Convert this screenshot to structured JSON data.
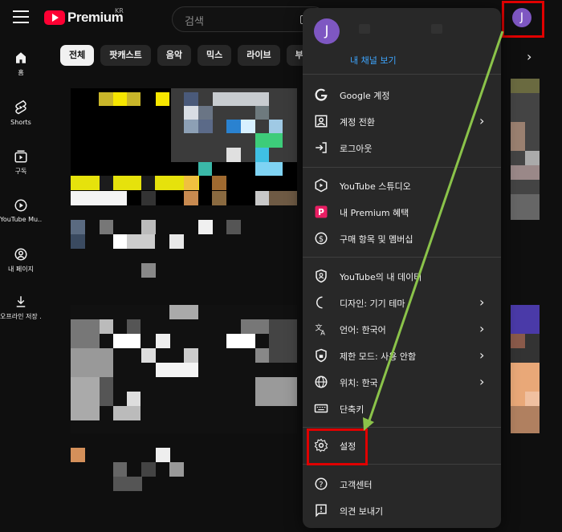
{
  "header": {
    "logo_text": "Premium",
    "region": "KR",
    "search_placeholder": "검색",
    "avatar_letter": "J"
  },
  "sidebar": {
    "items": [
      {
        "label": "홈",
        "icon": "home-icon"
      },
      {
        "label": "Shorts",
        "icon": "shorts-icon"
      },
      {
        "label": "구독",
        "icon": "subscriptions-icon"
      },
      {
        "label": "YouTube Mu...",
        "icon": "youtube-music-icon"
      },
      {
        "label": "내 페이지",
        "icon": "my-page-icon"
      },
      {
        "label": "오프라인 저장 ...",
        "icon": "download-icon"
      }
    ]
  },
  "chips": [
    "전체",
    "팟캐스트",
    "음악",
    "믹스",
    "라이브",
    "부동"
  ],
  "menu": {
    "avatar_letter": "J",
    "channel_link": "내 채널 보기",
    "items": [
      {
        "label": "Google 계정",
        "icon": "google-icon"
      },
      {
        "label": "계정 전환",
        "icon": "switch-account-icon"
      },
      {
        "label": "로그아웃",
        "icon": "sign-out-icon"
      },
      {
        "label": "YouTube 스튜디오",
        "icon": "studio-icon"
      },
      {
        "label": "내 Premium 혜택",
        "icon": "premium-icon"
      },
      {
        "label": "구매 항목 및 멤버십",
        "icon": "purchases-icon"
      },
      {
        "label": "YouTube의 내 데이터",
        "icon": "your-data-icon"
      },
      {
        "label": "디자인: 기기 테마",
        "icon": "theme-icon"
      },
      {
        "label": "언어: 한국어",
        "icon": "language-icon"
      },
      {
        "label": "제한 모드: 사용 안함",
        "icon": "restricted-mode-icon"
      },
      {
        "label": "위치: 한국",
        "icon": "location-icon"
      },
      {
        "label": "단축키",
        "icon": "keyboard-icon"
      },
      {
        "label": "설정",
        "icon": "settings-icon"
      },
      {
        "label": "고객센터",
        "icon": "help-icon"
      },
      {
        "label": "의견 보내기",
        "icon": "feedback-icon"
      }
    ]
  },
  "colors": {
    "annotation": "#e00000",
    "arrow": "#8bc34a",
    "link": "#3ea6ff",
    "avatar": "#7e57c2"
  }
}
